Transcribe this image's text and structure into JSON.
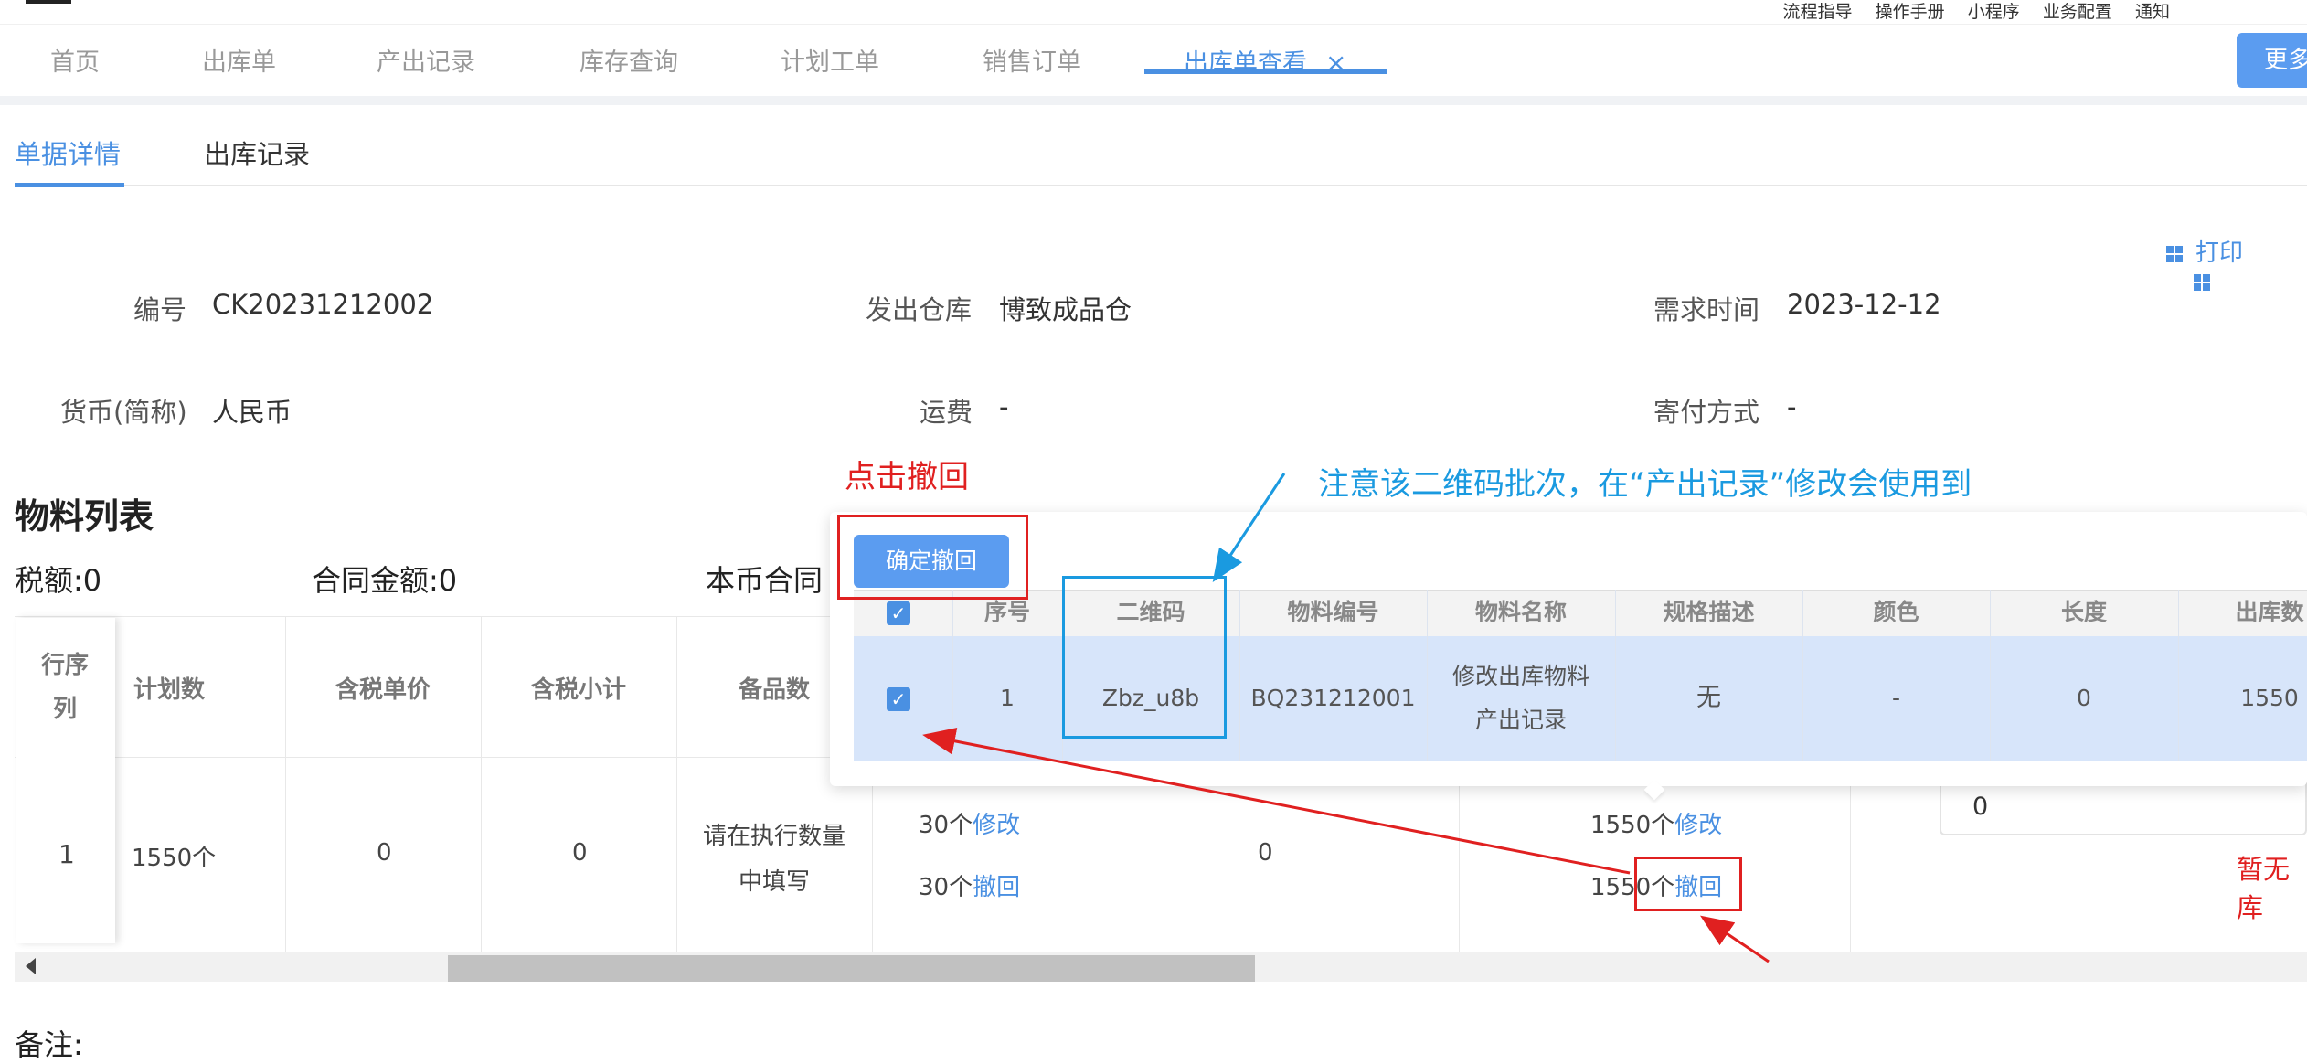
{
  "top_links": [
    "流程指导",
    "操作手册",
    "小程序",
    "业务配置",
    "通知"
  ],
  "tabs": [
    {
      "label": "首页"
    },
    {
      "label": "出库单"
    },
    {
      "label": "产出记录"
    },
    {
      "label": "库存查询"
    },
    {
      "label": "计划工单"
    },
    {
      "label": "销售订单"
    },
    {
      "label": "出库单查看"
    }
  ],
  "close_icon": "×",
  "more_label": "更多",
  "sub_tabs": [
    "单据详情",
    "出库记录"
  ],
  "print_label": "打印",
  "form": {
    "no_label": "编号",
    "no_value": "CK20231212002",
    "warehouse_label": "发出仓库",
    "warehouse_value": "博致成品仓",
    "demand_label": "需求时间",
    "demand_value": "2023-12-12",
    "currency_label": "货币(简称)",
    "currency_value": "人民币",
    "freight_label": "运费",
    "freight_value": "-",
    "delivery_label": "寄付方式",
    "delivery_value": "-"
  },
  "section_title": "物料列表",
  "summary": {
    "tax": "税额:0",
    "contract": "合同金额:0",
    "local_contract": "本币合同"
  },
  "main_table": {
    "headers": [
      "行序列",
      "计划数",
      "含税单价",
      "含税小计",
      "备品数"
    ],
    "row": {
      "index": "1",
      "plan": "1550个",
      "unit_price": "0",
      "subtotal": "0",
      "spare_line1": "请在执行数量",
      "spare_line2": "中填写",
      "c6_line1_qty": "30个",
      "c6_line1_link": "修改",
      "c6_line2_qty": "30个",
      "c6_line2_link": "撤回",
      "c7": "0",
      "c8_line1_qty": "1550个",
      "c8_line1_link": "修改",
      "c8_line2_qty": "1550个",
      "c8_line2_link": "撤回",
      "input_value": "0",
      "no_stock": "暂无库"
    }
  },
  "remark_label": "备注:",
  "popover": {
    "confirm_label": "确定撤回",
    "headers": [
      "序号",
      "二维码",
      "物料编号",
      "物料名称",
      "规格描述",
      "颜色",
      "长度",
      "出库数"
    ],
    "row": {
      "seq": "1",
      "qrcode": "Zbz_u8b",
      "material_no": "BQ231212001",
      "material_name_1": "修改出库物料",
      "material_name_2": "产出记录",
      "spec": "无",
      "color": "-",
      "length": "0",
      "out_qty": "1550"
    }
  },
  "annotations": {
    "click_recall": "点击撤回",
    "note": "注意该二维码批次，在“产出记录”修改会使用到"
  },
  "colors": {
    "accent": "#4a90e2",
    "annotation_red": "#e02020",
    "annotation_blue": "#1a9ae0",
    "selected_row": "#d7e5fa"
  }
}
